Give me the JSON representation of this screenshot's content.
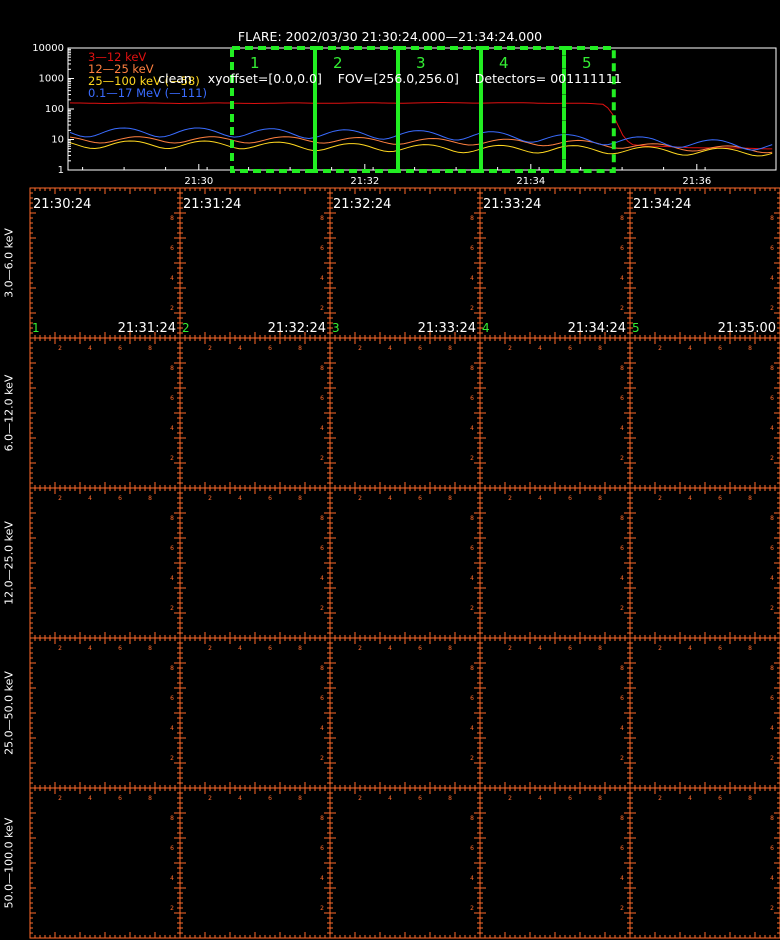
{
  "header": {
    "line1": "FLARE: 2002/03/30 21:30:24.000—21:34:24.000",
    "line2": "clean    xyoffset=[0.0,0.0]    FOV=[256.0,256.0]    Detectors= 001111111"
  },
  "colors": {
    "axis": "#ff6a2a",
    "highlight_box": "#22ee22",
    "series_3_12": "#e01010",
    "series_12_25": "#ff8040",
    "series_25_100": "#ffd820",
    "series_01_17": "#3a6cff",
    "interval_label": "#33ee33",
    "text": "#ffffff"
  },
  "chart_data": {
    "type": "line",
    "y_scale": "log",
    "ylim": [
      1,
      10000
    ],
    "y_tick_labels": [
      "1",
      "10",
      "100",
      "1000",
      "10000"
    ],
    "x_tick_labels": [
      "21:30",
      "21:32",
      "21:34",
      "21:36"
    ],
    "series": [
      {
        "name": "3—12 keV",
        "color_key": "series_3_12",
        "time_min": [
          0,
          0.5,
          1.0,
          1.5,
          2.0,
          2.5,
          3.0,
          3.5,
          4.0,
          4.3,
          4.5,
          4.6,
          4.7,
          4.8,
          5.0,
          5.5,
          6.0,
          6.5,
          7.0,
          7.5,
          8.0
        ],
        "values": [
          155,
          155,
          156,
          157,
          158,
          160,
          159,
          158,
          155,
          150,
          140,
          60,
          15,
          7,
          6,
          5.5,
          5.2,
          5,
          5,
          4.8,
          4.5
        ]
      },
      {
        "name": "12—25 keV",
        "color_key": "series_12_25",
        "time_min": [
          0,
          1,
          2,
          3,
          4,
          4.5,
          5,
          6,
          7,
          8
        ],
        "values": [
          10,
          10,
          9,
          8.5,
          8,
          7,
          6,
          5,
          4.5,
          4
        ]
      },
      {
        "name": "25—100 keV (—58)",
        "color_key": "series_25_100",
        "time_min": [
          0,
          1,
          2,
          3,
          4,
          5,
          6,
          7,
          8
        ],
        "values": [
          7,
          6,
          5.5,
          5,
          5,
          4.5,
          4,
          4,
          3
        ]
      },
      {
        "name": "0.1—17 MeV (—111)",
        "color_key": "series_01_17",
        "time_min": [
          0,
          1,
          2,
          3,
          4,
          5,
          6,
          7,
          8
        ],
        "values": [
          18,
          16,
          15,
          14,
          11,
          9,
          7,
          6,
          5
        ]
      }
    ],
    "intervals": [
      {
        "label": "1",
        "start_min": 0.0,
        "end_min": 1.0
      },
      {
        "label": "2",
        "start_min": 1.0,
        "end_min": 2.0
      },
      {
        "label": "3",
        "start_min": 2.0,
        "end_min": 3.0
      },
      {
        "label": "4",
        "start_min": 3.0,
        "end_min": 4.0
      },
      {
        "label": "5",
        "start_min": 4.0,
        "end_min": 4.6
      }
    ]
  },
  "grid": {
    "row_labels": [
      "3.0—6.0 keV",
      "6.0—12.0 keV",
      "12.0—25.0 keV",
      "25.0—50.0 keV",
      "50.0—100.0 keV"
    ],
    "col_start_times": [
      "21:30:24",
      "21:31:24",
      "21:32:24",
      "21:33:24",
      "21:34:24"
    ],
    "col_end_times": [
      "21:31:24",
      "21:32:24",
      "21:33:24",
      "21:34:24",
      "21:35:00"
    ],
    "col_numbers": [
      "1",
      "2",
      "3",
      "4",
      "5"
    ],
    "panel_tick_labels": [
      "2",
      "4",
      "6",
      "8"
    ]
  }
}
